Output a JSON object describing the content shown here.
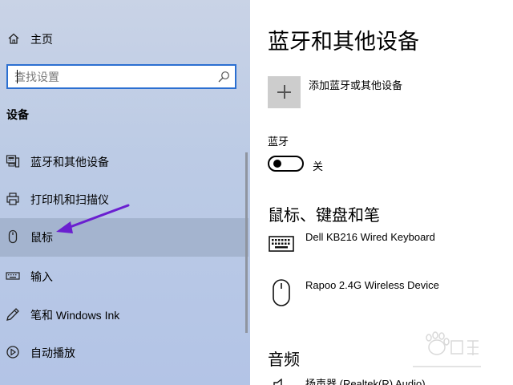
{
  "sidebar": {
    "home_label": "主页",
    "search_placeholder": "查找设置",
    "section_title": "设备",
    "items": [
      {
        "label": "蓝牙和其他设备",
        "icon": "bluetooth-devices-icon"
      },
      {
        "label": "打印机和扫描仪",
        "icon": "printer-icon"
      },
      {
        "label": "鼠标",
        "icon": "mouse-icon",
        "selected": true
      },
      {
        "label": "输入",
        "icon": "keyboard-icon"
      },
      {
        "label": "笔和 Windows Ink",
        "icon": "pen-icon"
      },
      {
        "label": "自动播放",
        "icon": "autoplay-icon"
      }
    ]
  },
  "main": {
    "title": "蓝牙和其他设备",
    "add_label": "添加蓝牙或其他设备",
    "bluetooth_label": "蓝牙",
    "bluetooth_state": "关",
    "bluetooth_on": false,
    "mice_section": "鼠标、键盘和笔",
    "devices": [
      {
        "name": "Dell KB216 Wired Keyboard",
        "icon": "keyboard-icon"
      },
      {
        "name": "Rapoo 2.4G Wireless Device",
        "icon": "mouse-icon"
      }
    ],
    "audio_section": "音频",
    "audio_device": "扬声器 (Realtek(R) Audio)"
  },
  "colors": {
    "sidebar_bg": "#bccbe5",
    "search_border": "#2b6fd1",
    "annotation_arrow": "#6a1fd0",
    "selected_bg": "#a9b4c8"
  }
}
